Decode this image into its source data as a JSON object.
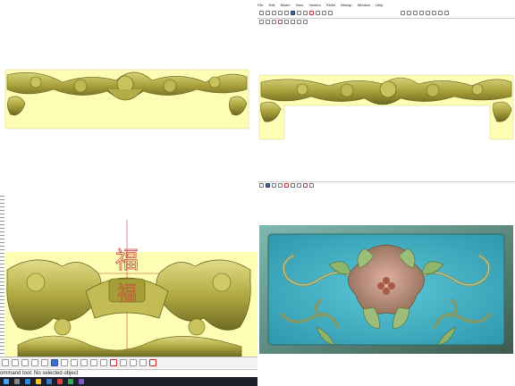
{
  "top_right": {
    "menu": [
      "File",
      "Edit",
      "Model",
      "View",
      "Vectors",
      "Relief",
      "Bitmap",
      "Window",
      "Help"
    ]
  },
  "bottom_left": {
    "status_text": "ommand tool: No selected object",
    "character": "福"
  },
  "colors": {
    "relief_gold": "#b7b253",
    "relief_dark": "#6f6a22",
    "background_yellow": "#fdfdb4",
    "panel_teal": "#3fb2c7",
    "panel_frame": "#4f6a5a",
    "flower_pink": "#c98a83",
    "character_red": "#d04040"
  }
}
